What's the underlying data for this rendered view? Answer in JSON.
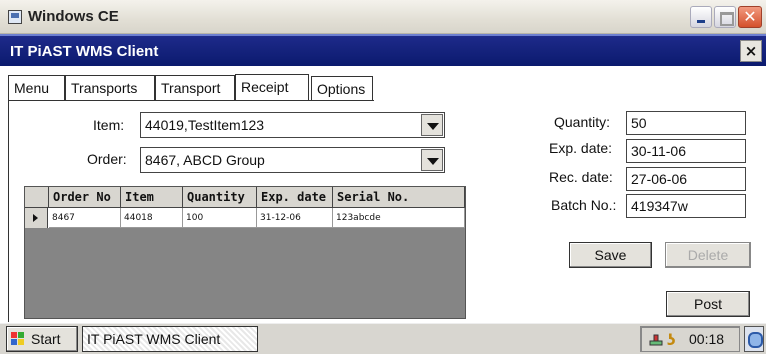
{
  "window": {
    "title": "Windows CE",
    "close_glyph": "✕"
  },
  "app": {
    "title": "IT PiAST WMS Client",
    "close_glyph": "×"
  },
  "tabs": [
    {
      "label": "Menu"
    },
    {
      "label": "Transports"
    },
    {
      "label": "Transport"
    },
    {
      "label": "Receipt",
      "active": true
    },
    {
      "label": "Options"
    }
  ],
  "form": {
    "item_label": "Item:",
    "item_value": "44019,TestItem123",
    "order_label": "Order:",
    "order_value": "8467, ABCD Group"
  },
  "grid": {
    "columns": [
      "Order No",
      "Item",
      "Quantity",
      "Exp. date",
      "Serial No."
    ],
    "rows": [
      [
        "8467",
        "44018",
        "100",
        "31-12-06",
        "123abcde"
      ]
    ]
  },
  "details": {
    "quantity_label": "Quantity:",
    "quantity_value": "50",
    "exp_label": "Exp. date:",
    "exp_value": "30-11-06",
    "rec_label": "Rec. date:",
    "rec_value": "27-06-06",
    "batch_label": "Batch No.:",
    "batch_value": "419347w"
  },
  "buttons": {
    "save": "Save",
    "delete": "Delete",
    "post": "Post"
  },
  "taskbar": {
    "start": "Start",
    "task": "IT PiAST WMS Client",
    "time": "00:18"
  },
  "colors": {
    "app_bar": "#0b1a6e",
    "grid_bg": "#858585"
  },
  "icons": [
    "window-app-icon",
    "minimize-icon",
    "maximize-icon",
    "close-icon",
    "dropdown-arrow-icon",
    "row-pointer-icon",
    "start-flag-icon",
    "network-icon",
    "clock-icon",
    "desktop-icon"
  ]
}
